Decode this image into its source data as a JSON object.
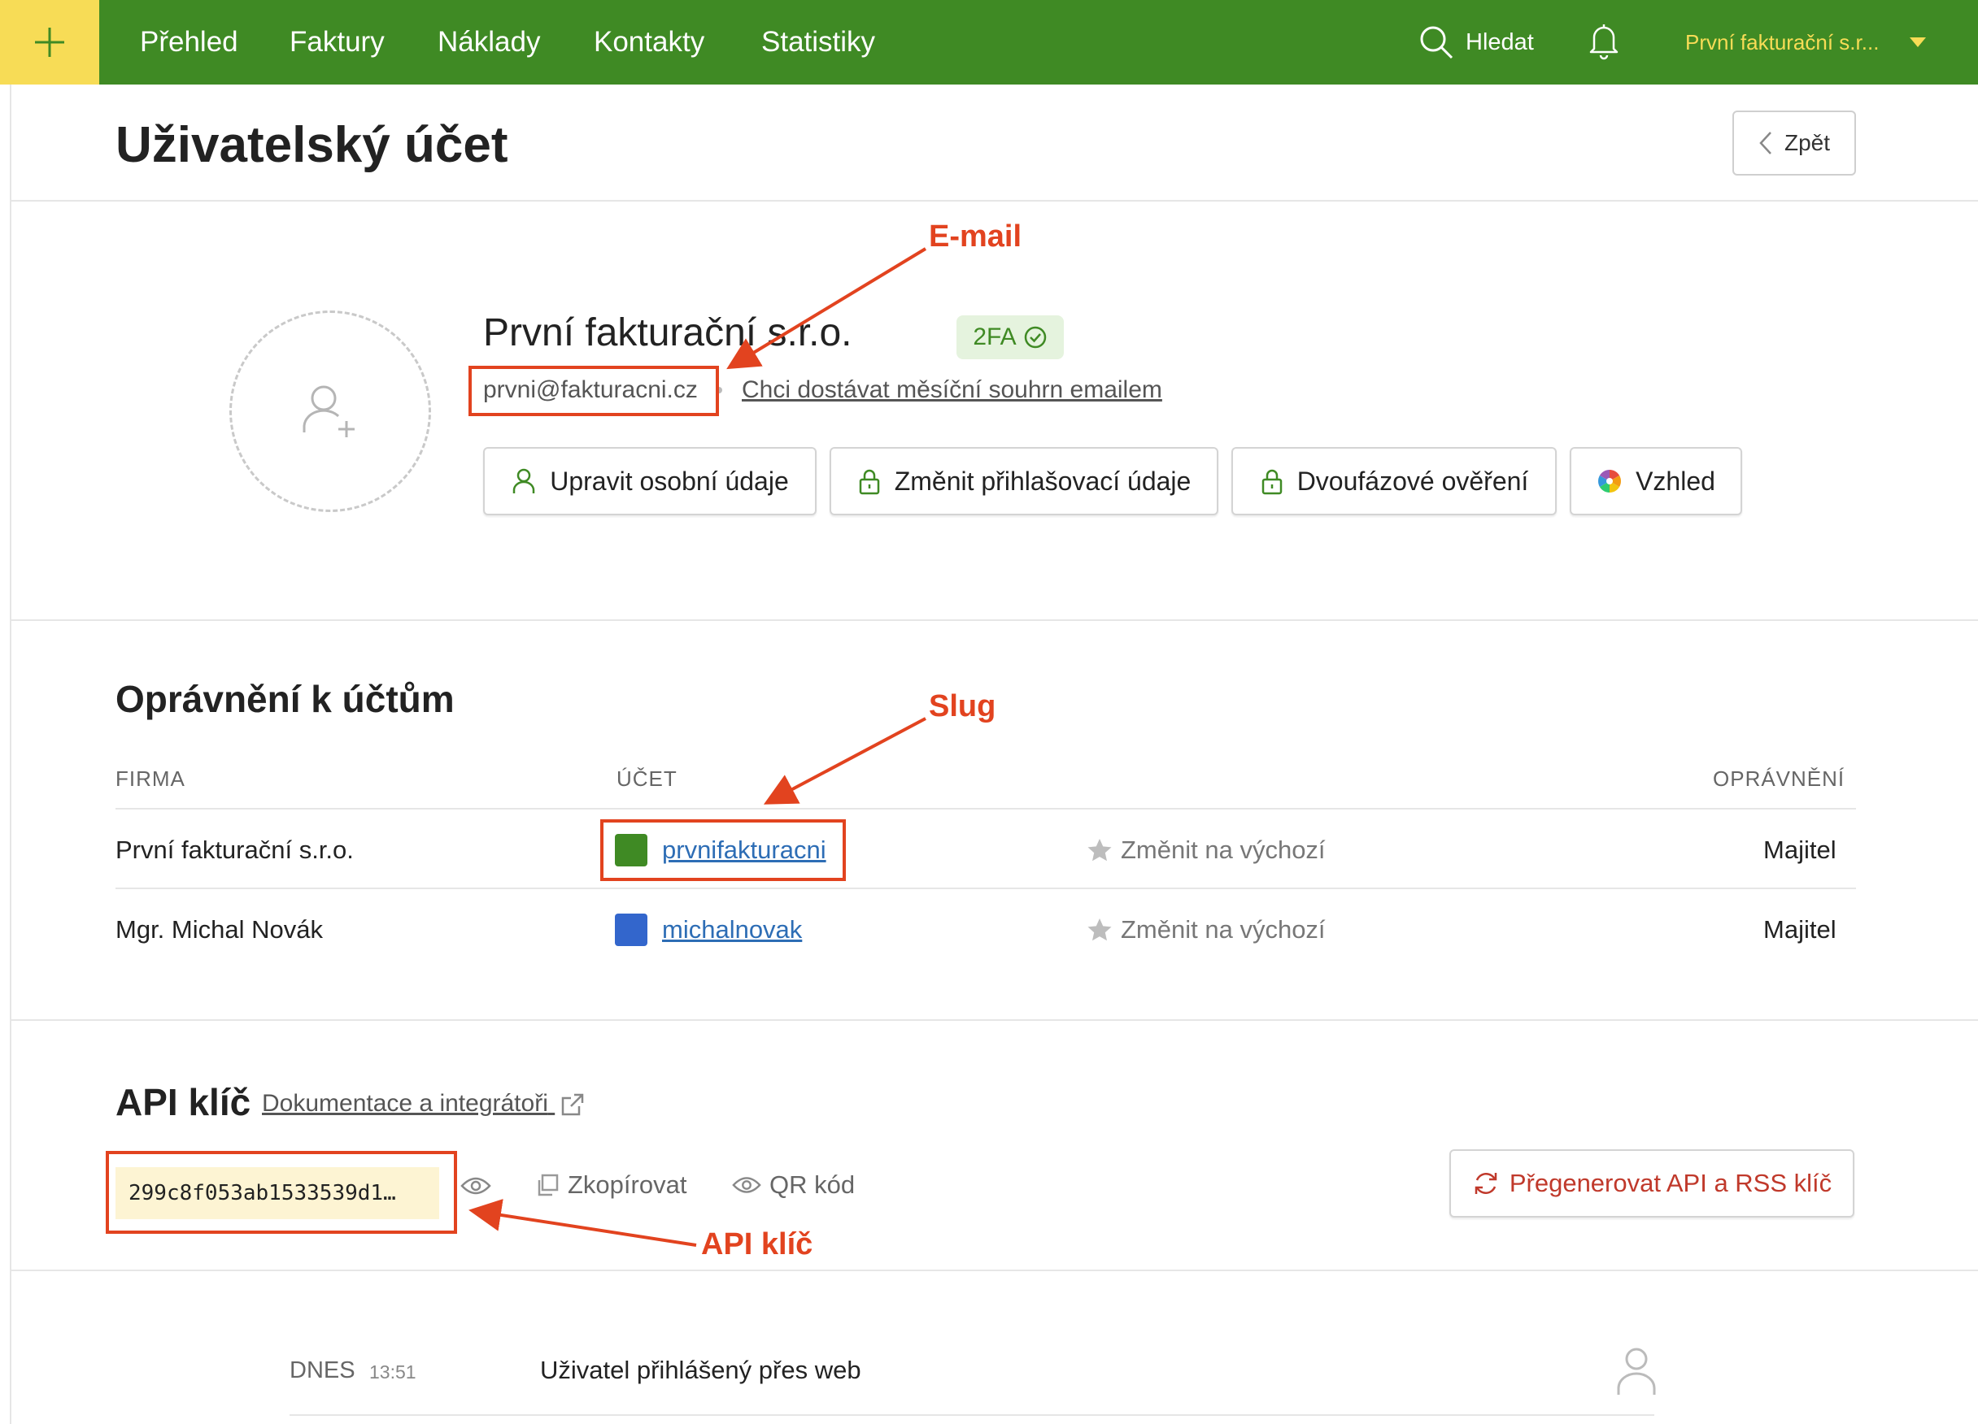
{
  "nav": {
    "items": [
      "Přehled",
      "Faktury",
      "Náklady",
      "Kontakty",
      "Statistiky"
    ],
    "search_label": "Hledat",
    "account_name": "První fakturační s.r...",
    "colors": {
      "bar": "#3f8a24",
      "plus_bg": "#f7dc56",
      "account_text": "#f7dc56"
    }
  },
  "page": {
    "title": "Uživatelský účet",
    "back_label": "Zpět"
  },
  "profile": {
    "company_name": "První fakturační s.r.o.",
    "badge_2fa": "2FA",
    "email": "prvni@fakturacni.cz",
    "summary_link": "Chci dostávat měsíční souhrn emailem",
    "actions": [
      {
        "label": "Upravit osobní údaje",
        "icon": "user-icon"
      },
      {
        "label": "Změnit přihlašovací údaje",
        "icon": "lock-icon"
      },
      {
        "label": "Dvoufázové ověření",
        "icon": "lock-icon"
      },
      {
        "label": "Vzhled",
        "icon": "color-wheel-icon"
      }
    ]
  },
  "permissions": {
    "title": "Oprávnění k účtům",
    "headers": {
      "firm": "FIRMA",
      "account": "ÚČET",
      "permission": "OPRÁVNĚNÍ"
    },
    "rows": [
      {
        "firm": "První fakturační s.r.o.",
        "slug": "prvnifakturacni",
        "color": "#3f8a24",
        "default_label": "Změnit na výchozí",
        "permission": "Majitel"
      },
      {
        "firm": "Mgr. Michal Novák",
        "slug": "michalnovak",
        "color": "#3366cc",
        "default_label": "Změnit na výchozí",
        "permission": "Majitel"
      }
    ]
  },
  "api": {
    "title": "API klíč",
    "docs_link": "Dokumentace a integrátoři",
    "key_value": "299c8f053ab1533539d1…",
    "copy_label": "Zkopírovat",
    "qr_label": "QR kód",
    "regenerate_label": "Přegenerovat API a RSS klíč"
  },
  "activity": {
    "items": [
      {
        "day": "DNES",
        "time": "13:51",
        "text": "Uživatel přihlášený přes web"
      }
    ]
  },
  "annotations": {
    "email_label": "E-mail",
    "slug_label": "Slug",
    "api_label": "API klíč",
    "color": "#e2431f"
  }
}
